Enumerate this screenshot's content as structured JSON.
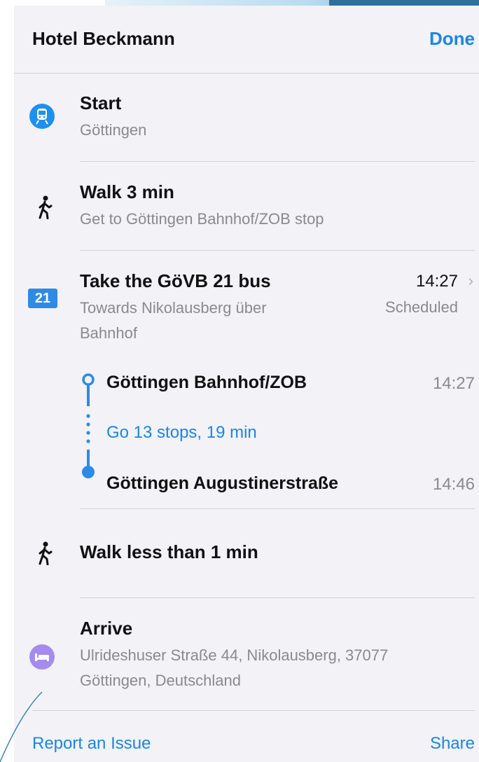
{
  "header": {
    "title": "Hotel Beckmann",
    "done_label": "Done"
  },
  "steps": {
    "start": {
      "title": "Start",
      "subtitle": "Göttingen",
      "icon": "train-icon"
    },
    "walk1": {
      "title": "Walk 3 min",
      "subtitle": "Get to Göttingen Bahnhof/ZOB stop",
      "icon": "walk-icon"
    },
    "bus": {
      "badge": "21",
      "title": "Take the GöVB 21 bus",
      "subtitle": "Towards Nikolausberg über Bahnhof",
      "time": "14:27",
      "status": "Scheduled",
      "from_stop": "Göttingen Bahnhof/ZOB",
      "from_time": "14:27",
      "stops_summary": "Go 13 stops, 19 min",
      "to_stop": "Göttingen Augustinerstraße",
      "to_time": "14:46"
    },
    "walk2": {
      "title": "Walk less than 1 min",
      "icon": "walk-icon"
    },
    "arrive": {
      "title": "Arrive",
      "subtitle": "Ulrideshuser Straße 44, Nikolausberg, 37077 Göttingen, Deutschland",
      "icon": "bed-icon"
    }
  },
  "footer": {
    "report_label": "Report an Issue",
    "share_label": "Share"
  },
  "colors": {
    "accent": "#1a86e8",
    "start_icon": "#1e90f0",
    "bus_badge": "#2d8ae6",
    "arrive_icon": "#a58af0"
  }
}
